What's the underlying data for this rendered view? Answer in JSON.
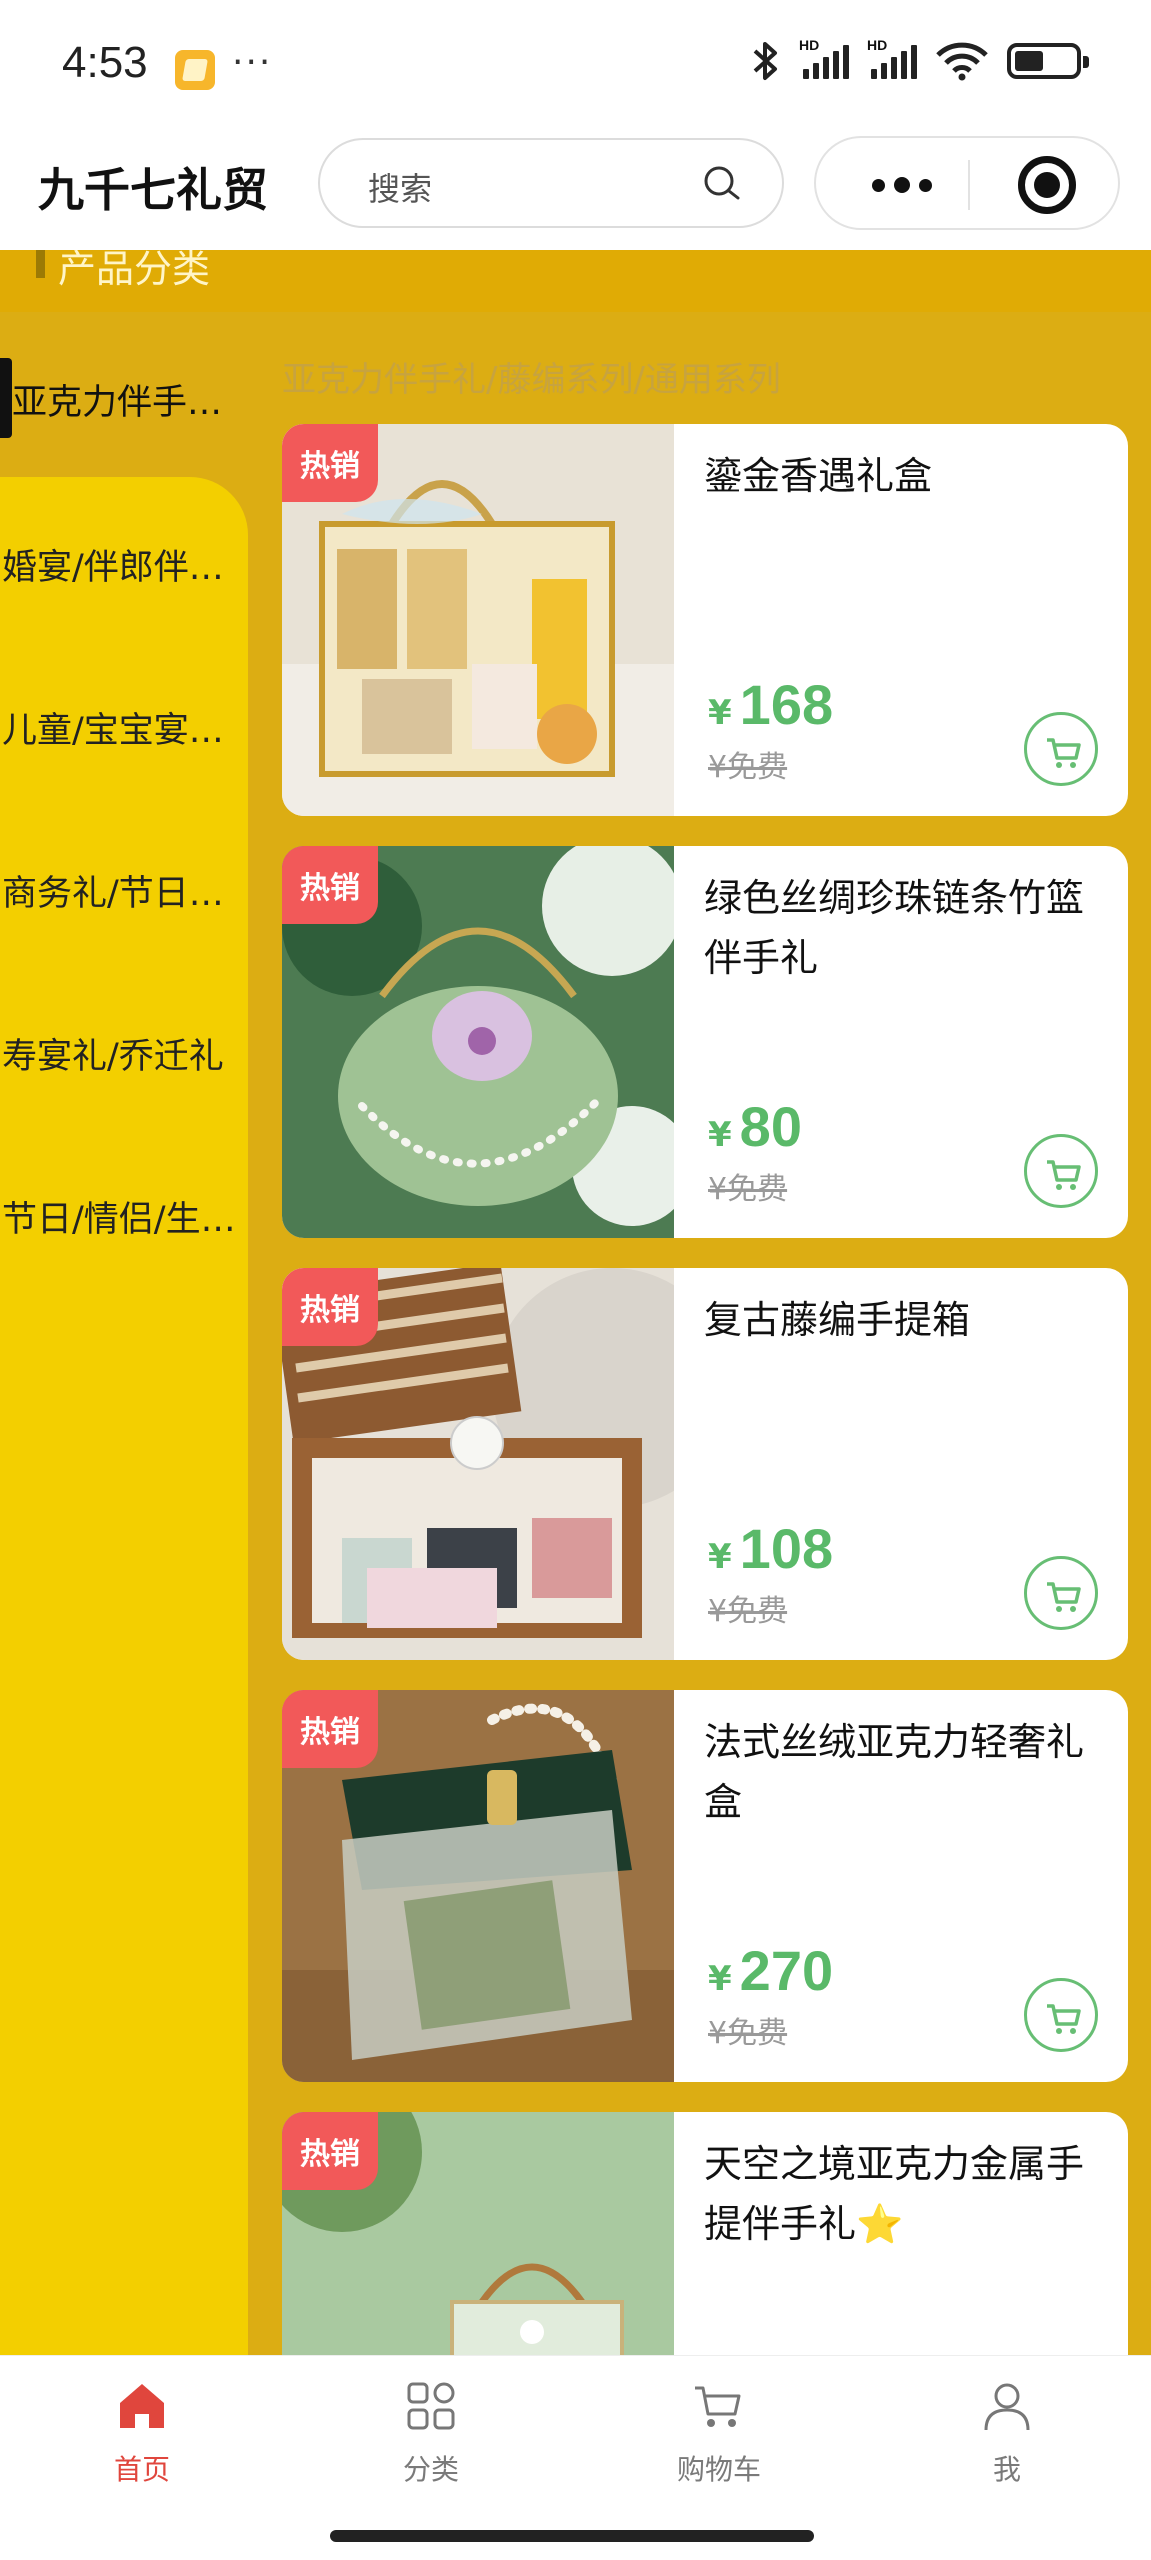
{
  "status_bar": {
    "time": "4:53",
    "more": "···",
    "signal1_label": "HD",
    "signal2_label": "HD"
  },
  "header": {
    "title": "九千七礼贸",
    "search_placeholder": "搜索"
  },
  "section": {
    "title": "产品分类"
  },
  "breadcrumb": "亚克力伴手礼/藤编系列/通用系列",
  "sidebar": {
    "active": "亚克力伴手礼/藤编系列/通用系列",
    "items": [
      "婚宴/伴郎伴娘礼",
      "儿童/宝宝宴回礼",
      "商务礼/节日福利",
      "寿宴礼/乔迁礼",
      "节日/情侣/生日礼"
    ]
  },
  "products": [
    {
      "badge": "热销",
      "name": "鎏金香遇礼盒",
      "currency": "¥",
      "price": "168",
      "shipping": "¥免费"
    },
    {
      "badge": "热销",
      "name": "绿色丝绸珍珠链条竹篮伴手礼",
      "currency": "¥",
      "price": "80",
      "shipping": "¥免费"
    },
    {
      "badge": "热销",
      "name": "复古藤编手提箱",
      "currency": "¥",
      "price": "108",
      "shipping": "¥免费"
    },
    {
      "badge": "热销",
      "name": "法式丝绒亚克力轻奢礼盒",
      "currency": "¥",
      "price": "270",
      "shipping": "¥免费"
    },
    {
      "badge": "热销",
      "name": "天空之境亚克力金属手提伴手礼⭐",
      "currency": "¥",
      "price": "",
      "shipping": ""
    }
  ],
  "tabs": [
    {
      "label": "首页",
      "icon": "home-icon",
      "active": true
    },
    {
      "label": "分类",
      "icon": "category-icon",
      "active": false
    },
    {
      "label": "购物车",
      "icon": "cart-icon",
      "active": false
    },
    {
      "label": "我",
      "icon": "user-icon",
      "active": false
    }
  ],
  "colors": {
    "gold_bg": "#dcad13",
    "sidebar_yellow": "#f3cf00",
    "price_green": "#5ab969",
    "hot_red": "#f25959",
    "tab_active": "#e0463d"
  }
}
